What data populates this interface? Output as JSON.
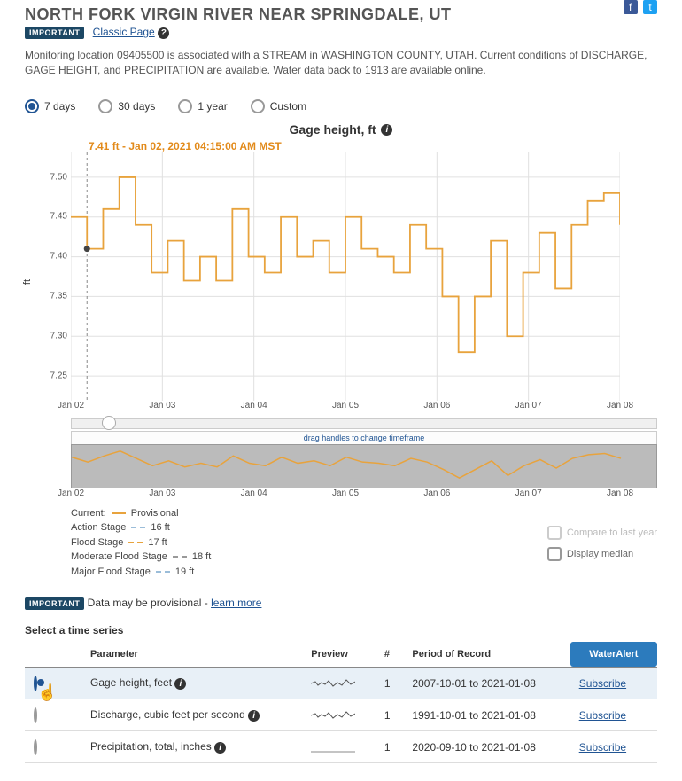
{
  "header": {
    "title": "NORTH FORK VIRGIN RIVER NEAR SPRINGDALE, UT",
    "important_badge": "IMPORTANT",
    "classic_link": "Classic Page"
  },
  "description": "Monitoring location 09405500 is associated with a STREAM in WASHINGTON COUNTY, UTAH. Current conditions of DISCHARGE, GAGE HEIGHT, and PRECIPITATION are available. Water data back to 1913 are available online.",
  "range_radios": [
    "7 days",
    "30 days",
    "1 year",
    "Custom"
  ],
  "selected_range": "7 days",
  "chart_title": "Gage height, ft",
  "tooltip_text": "7.41 ft - Jan 02, 2021 04:15:00 AM MST",
  "y_axis_label": "ft",
  "slider_note": "drag handles to change timeframe",
  "legend": {
    "current": "Current:",
    "provisional": "Provisional",
    "action_stage": {
      "label": "Action Stage",
      "value": "16 ft"
    },
    "flood_stage": {
      "label": "Flood Stage",
      "value": "17 ft"
    },
    "moderate": {
      "label": "Moderate Flood Stage",
      "value": "18 ft"
    },
    "major": {
      "label": "Major Flood Stage",
      "value": "19 ft"
    }
  },
  "options": {
    "compare": "Compare to last year",
    "median": "Display median"
  },
  "provisional_note": {
    "text": "Data may be provisional - ",
    "link": "learn more"
  },
  "table": {
    "heading": "Select a time series",
    "columns": [
      "Parameter",
      "Preview",
      "#",
      "Period of Record",
      "WaterAlert"
    ],
    "rows": [
      {
        "selected": true,
        "param": "Gage height, feet",
        "count": "1",
        "period": "2007-10-01 to 2021-01-08",
        "alert": "Subscribe"
      },
      {
        "selected": false,
        "param": "Discharge, cubic feet per second",
        "count": "1",
        "period": "1991-10-01 to 2021-01-08",
        "alert": "Subscribe"
      },
      {
        "selected": false,
        "param": "Precipitation, total, inches",
        "count": "1",
        "period": "2020-09-10 to 2021-01-08",
        "alert": "Subscribe"
      }
    ]
  },
  "chart_data": {
    "type": "line",
    "title": "Gage height, ft",
    "ylabel": "ft",
    "ylim": [
      7.23,
      7.52
    ],
    "yticks": [
      7.25,
      7.3,
      7.35,
      7.4,
      7.45,
      7.5
    ],
    "xticks": [
      "Jan 02",
      "Jan 03",
      "Jan 04",
      "Jan 05",
      "Jan 06",
      "Jan 07",
      "Jan 08"
    ],
    "tooltip_point": {
      "x": "2021-01-02T04:15:00",
      "y": 7.41
    },
    "series": [
      {
        "name": "Provisional",
        "x": [
          "Jan 02 00:00",
          "Jan 02 04:15",
          "Jan 02 08:00",
          "Jan 02 12:00",
          "Jan 02 18:00",
          "Jan 02 20:00",
          "Jan 03 00:00",
          "Jan 03 02:00",
          "Jan 03 06:00",
          "Jan 03 09:00",
          "Jan 03 12:00",
          "Jan 03 18:00",
          "Jan 04 00:00",
          "Jan 04 06:00",
          "Jan 04 12:00",
          "Jan 04 18:00",
          "Jan 05 00:00",
          "Jan 05 06:00",
          "Jan 05 10:00",
          "Jan 05 18:00",
          "Jan 06 00:00",
          "Jan 06 06:00",
          "Jan 06 12:00",
          "Jan 06 14:00",
          "Jan 06 18:00",
          "Jan 07 00:00",
          "Jan 07 04:00",
          "Jan 07 06:00",
          "Jan 07 12:00",
          "Jan 07 18:00",
          "Jan 08 00:00",
          "Jan 08 06:00",
          "Jan 08 12:00",
          "Jan 08 18:00",
          "Jan 08 22:00"
        ],
        "values": [
          7.45,
          7.41,
          7.46,
          7.5,
          7.44,
          7.38,
          7.42,
          7.37,
          7.4,
          7.37,
          7.46,
          7.4,
          7.38,
          7.45,
          7.4,
          7.42,
          7.38,
          7.45,
          7.41,
          7.4,
          7.38,
          7.44,
          7.41,
          7.35,
          7.28,
          7.35,
          7.42,
          7.3,
          7.38,
          7.43,
          7.36,
          7.44,
          7.47,
          7.48,
          7.44
        ]
      }
    ]
  }
}
